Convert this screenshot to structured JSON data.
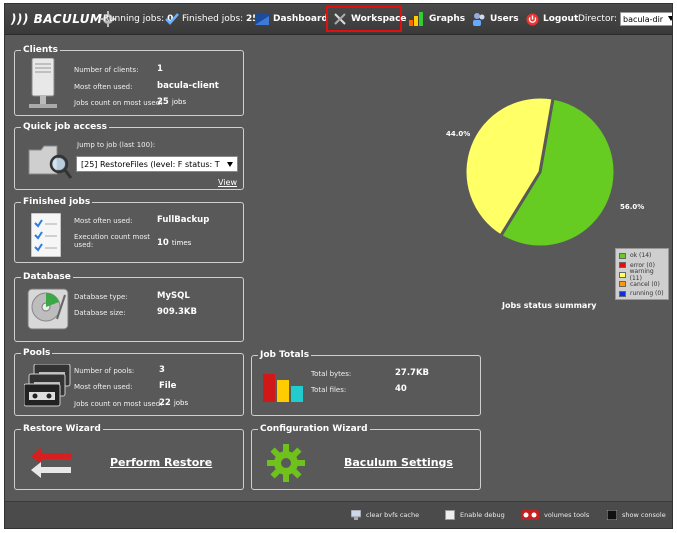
{
  "topbar": {
    "logo": "))) BACULUM",
    "running_label": "Running jobs:",
    "running_count": "0",
    "finished_label": "Finished jobs:",
    "finished_count": "25",
    "nav": {
      "dashboard": "Dashboard",
      "workspace": "Workspace",
      "graphs": "Graphs",
      "users": "Users",
      "logout": "Logout"
    },
    "director_label": "Director:",
    "director_value": "bacula-dir"
  },
  "clients": {
    "title": "Clients",
    "number_label": "Number of clients:",
    "number_value": "1",
    "most_used_label": "Most often used:",
    "most_used_value": "bacula-client",
    "jobs_count_label": "Jobs count on most used:",
    "jobs_count_value": "25",
    "jobs_unit": "jobs"
  },
  "quick_job": {
    "title": "Quick job access",
    "jump_label": "Jump to job (last 100):",
    "selected_job": "[25] RestoreFiles (level: F status: T",
    "view_link": "View"
  },
  "finished_jobs": {
    "title": "Finished jobs",
    "most_used_label": "Most often used:",
    "most_used_value": "FullBackup",
    "exec_label_1": "Execution count most",
    "exec_label_2": "used:",
    "exec_value": "10",
    "exec_unit": "times"
  },
  "database": {
    "title": "Database",
    "type_label": "Database type:",
    "type_value": "MySQL",
    "size_label": "Database size:",
    "size_value": "909.3KB"
  },
  "pools": {
    "title": "Pools",
    "number_label": "Number of pools:",
    "number_value": "3",
    "most_used_label": "Most often used:",
    "most_used_value": "File",
    "jobs_count_label": "Jobs count on most used:",
    "jobs_count_value": "22",
    "jobs_unit": "jobs"
  },
  "job_totals": {
    "title": "Job Totals",
    "bytes_label": "Total bytes:",
    "bytes_value": "27.7KB",
    "files_label": "Total files:",
    "files_value": "40"
  },
  "restore_wizard": {
    "title": "Restore Wizard",
    "link": "Perform Restore"
  },
  "config_wizard": {
    "title": "Configuration Wizard",
    "link": "Baculum Settings"
  },
  "chart_data": {
    "type": "pie",
    "title": "Jobs status summary",
    "slices": [
      {
        "label": "ok (14)",
        "value": 56.0,
        "color": "#66cc22"
      },
      {
        "label": "error (0)",
        "value": 0,
        "color": "#e01010"
      },
      {
        "label": "warning (11)",
        "value": 44.0,
        "color": "#ffff66"
      },
      {
        "label": "cancel (0)",
        "value": 0,
        "color": "#ff9900"
      },
      {
        "label": "running (0)",
        "value": 0,
        "color": "#1030e0"
      }
    ],
    "labels": {
      "ok": "56.0%",
      "warning": "44.0%"
    }
  },
  "footer": {
    "clear_cache": "clear bvfs cache",
    "enable_debug": "Enable debug",
    "volumes_tools": "volumes tools",
    "show_console": "show console"
  }
}
